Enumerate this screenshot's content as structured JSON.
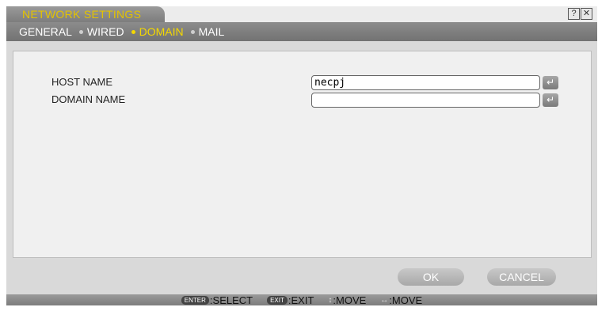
{
  "window": {
    "title": "NETWORK SETTINGS",
    "help_icon": "?",
    "close_icon": "✕"
  },
  "tabs": [
    {
      "label": "GENERAL",
      "active": false
    },
    {
      "label": "WIRED",
      "active": false
    },
    {
      "label": "DOMAIN",
      "active": true
    },
    {
      "label": "MAIL",
      "active": false
    }
  ],
  "form": {
    "host_name": {
      "label": "HOST NAME",
      "value": "necpj"
    },
    "domain_name": {
      "label": "DOMAIN NAME",
      "value": ""
    },
    "enter_glyph": "↵"
  },
  "buttons": {
    "ok": "OK",
    "cancel": "CANCEL"
  },
  "help_bar": [
    {
      "key": "ENTER",
      "action": ":SELECT"
    },
    {
      "key": "EXIT",
      "action": ":EXIT"
    },
    {
      "key": "↕",
      "action": ":MOVE"
    },
    {
      "key": "↔",
      "action": ":MOVE"
    }
  ],
  "colors": {
    "active_tab": "#f5d800",
    "title_text": "#e3c300"
  }
}
